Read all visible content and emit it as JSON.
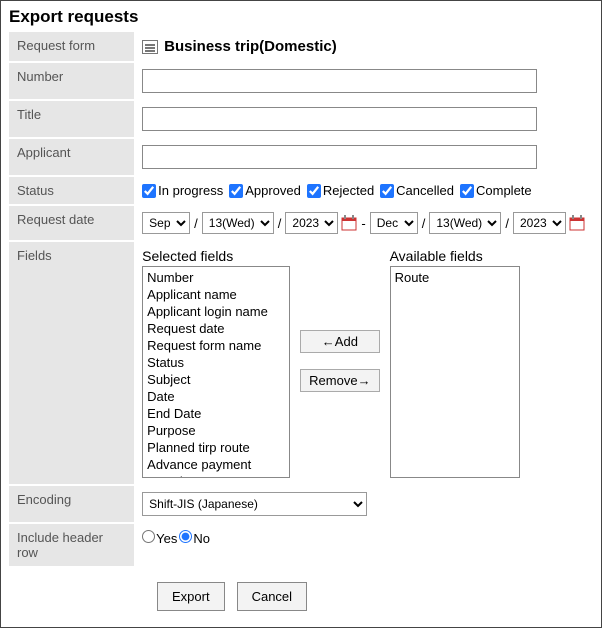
{
  "title": "Export requests",
  "labels": {
    "request_form": "Request form",
    "number": "Number",
    "title_field": "Title",
    "applicant": "Applicant",
    "status": "Status",
    "request_date": "Request date",
    "fields": "Fields",
    "encoding": "Encoding",
    "include_header": "Include header row"
  },
  "form_name": "Business trip(Domestic)",
  "inputs": {
    "number": "",
    "title": "",
    "applicant": ""
  },
  "status_options": {
    "in_progress": "In progress",
    "approved": "Approved",
    "rejected": "Rejected",
    "cancelled": "Cancelled",
    "complete": "Complete"
  },
  "date": {
    "sep": "/",
    "range_sep": "-",
    "from_month": "Sep",
    "from_day": "13(Wed)",
    "from_year": "2023",
    "to_month": "Dec",
    "to_day": "13(Wed)",
    "to_year": "2023"
  },
  "fields_section": {
    "selected_title": "Selected fields",
    "available_title": "Available fields",
    "selected": [
      "Number",
      "Applicant name",
      "Applicant login name",
      "Request date",
      "Request form name",
      "Status",
      "Subject",
      "Date",
      "End Date",
      "Purpose",
      "Planned tirp route",
      "Advance payment",
      "Travel expense"
    ],
    "available": [
      "Route"
    ],
    "add_btn": "←Add",
    "remove_btn": "Remove→"
  },
  "encoding_value": "Shift-JIS (Japanese)",
  "header_row": {
    "yes": "Yes",
    "no": "No"
  },
  "buttons": {
    "export": "Export",
    "cancel": "Cancel"
  }
}
